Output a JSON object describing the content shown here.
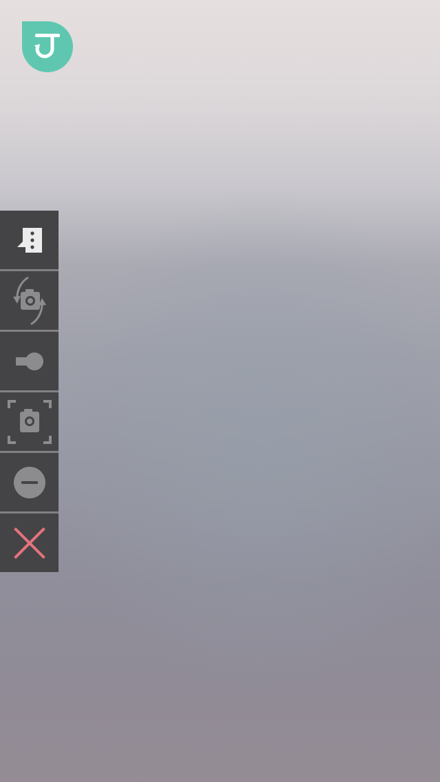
{
  "app": {
    "logo_icon": "app-logo-icon",
    "logo_color": "#5fc7b0"
  },
  "toolbar": {
    "background_color": "#444446",
    "icon_color": "#8c8c8e",
    "close_color": "#e5737d",
    "buttons": [
      {
        "id": "menu",
        "icon": "chat-more-icon"
      },
      {
        "id": "switch-camera",
        "icon": "switch-camera-icon"
      },
      {
        "id": "flash",
        "icon": "flashlight-icon"
      },
      {
        "id": "screenshot",
        "icon": "capture-frame-icon"
      },
      {
        "id": "mute",
        "icon": "minus-circle-icon"
      },
      {
        "id": "close",
        "icon": "close-icon"
      }
    ]
  }
}
